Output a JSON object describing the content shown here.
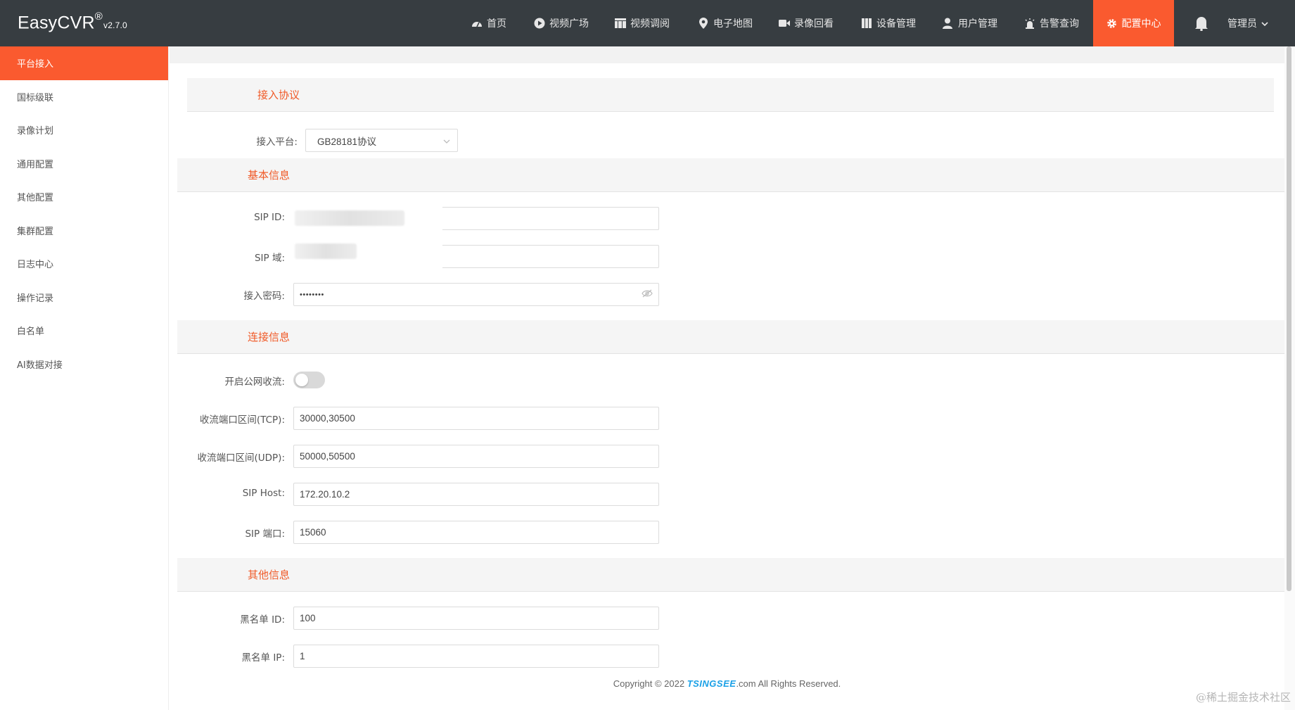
{
  "app": {
    "name": "EasyCVR",
    "reg": "®",
    "version": "v2.7.0"
  },
  "nav": [
    {
      "label": "首页",
      "icon": "dashboard-icon"
    },
    {
      "label": "视频广场",
      "icon": "play-icon"
    },
    {
      "label": "视频调阅",
      "icon": "grid-icon"
    },
    {
      "label": "电子地图",
      "icon": "map-pin-icon"
    },
    {
      "label": "录像回看",
      "icon": "video-camera-icon"
    },
    {
      "label": "设备管理",
      "icon": "device-icon"
    },
    {
      "label": "用户管理",
      "icon": "user-icon"
    },
    {
      "label": "告警查询",
      "icon": "alarm-icon"
    },
    {
      "label": "配置中心",
      "icon": "gear-icon",
      "active": true
    }
  ],
  "user": {
    "label": "管理员"
  },
  "sidebar": [
    {
      "label": "平台接入",
      "active": true
    },
    {
      "label": "国标级联"
    },
    {
      "label": "录像计划"
    },
    {
      "label": "通用配置"
    },
    {
      "label": "其他配置"
    },
    {
      "label": "集群配置"
    },
    {
      "label": "日志中心"
    },
    {
      "label": "操作记录"
    },
    {
      "label": "白名单"
    },
    {
      "label": "AI数据对接"
    }
  ],
  "sections": {
    "protocol": "接入协议",
    "basic": "基本信息",
    "connection": "连接信息",
    "other": "其他信息"
  },
  "form": {
    "platform": {
      "label": "接入平台:",
      "value": "GB28181协议"
    },
    "sip_id": {
      "label": "SIP ID:",
      "value": ""
    },
    "sip_domain": {
      "label": "SIP 域:",
      "value": ""
    },
    "password": {
      "label": "接入密码:",
      "value": "••••••••"
    },
    "public_stream": {
      "label": "开启公网收流:",
      "enabled": false
    },
    "tcp_range": {
      "label": "收流端口区间(TCP):",
      "value": "30000,30500"
    },
    "udp_range": {
      "label": "收流端口区间(UDP):",
      "value": "50000,50500"
    },
    "sip_host": {
      "label": "SIP Host:",
      "value": "172.20.10.2"
    },
    "sip_port": {
      "label": "SIP 端口:",
      "value": "15060"
    },
    "blacklist_id": {
      "label": "黑名单 ID:",
      "value": "100"
    },
    "blacklist_ip": {
      "label": "黑名单 IP:",
      "value": "1"
    }
  },
  "footer": {
    "prefix": "Copyright © 2022 ",
    "brand": "TSINGSEE",
    "suffix": ".com All Rights Reserved."
  },
  "watermark": "@稀土掘金技术社区",
  "colors": {
    "topbar": "#373d41",
    "accent": "#fa5a2f",
    "section_title": "#f05a28"
  }
}
